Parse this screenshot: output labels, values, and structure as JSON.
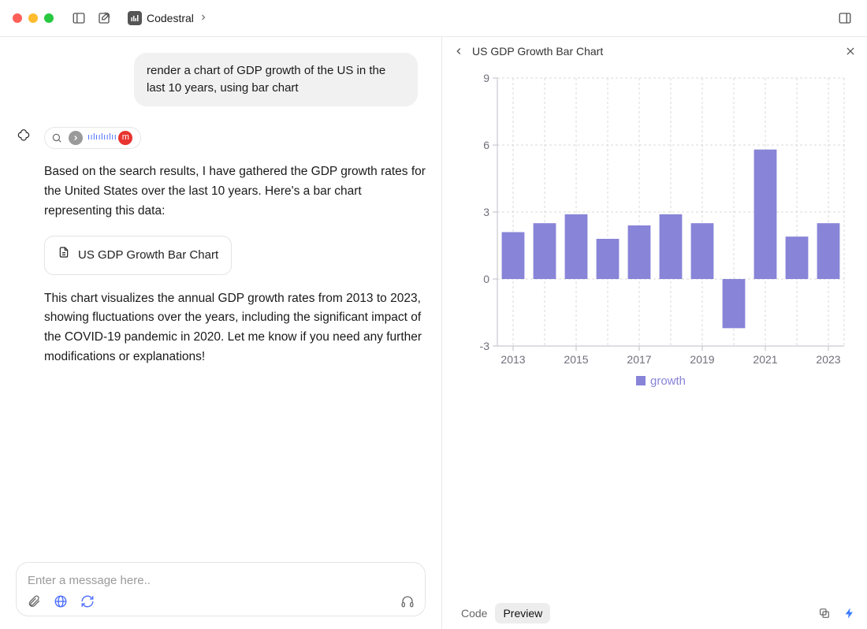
{
  "titlebar": {
    "model_name": "Codestral"
  },
  "chat": {
    "user_message": "render a chart of GDP growth of the US in the last 10 years, using bar chart",
    "assistant_para1": "Based on the search results, I have gathered the GDP growth rates for the United States over the last 10 years. Here's a bar chart representing this data:",
    "artifact_label": "US GDP Growth Bar Chart",
    "assistant_para2": "This chart visualizes the annual GDP growth rates from 2013 to 2023, showing fluctuations over the years, including the significant impact of the COVID-19 pandemic in 2020. Let me know if you need any further modifications or explanations!"
  },
  "composer": {
    "placeholder": "Enter a message here.."
  },
  "viewer": {
    "title": "US GDP Growth Bar Chart",
    "tab_code": "Code",
    "tab_preview": "Preview"
  },
  "chart_data": {
    "type": "bar",
    "series_name": "growth",
    "categories": [
      2013,
      2014,
      2015,
      2016,
      2017,
      2018,
      2019,
      2020,
      2021,
      2022,
      2023
    ],
    "values": [
      2.1,
      2.5,
      2.9,
      1.8,
      2.4,
      2.9,
      2.5,
      -2.2,
      5.8,
      1.9,
      2.5
    ],
    "x_tick_labels": [
      "2013",
      "2015",
      "2017",
      "2019",
      "2021",
      "2023"
    ],
    "y_ticks": [
      -3,
      0,
      3,
      6,
      9
    ],
    "ylim": [
      -3,
      9
    ],
    "bar_color": "#8884d8",
    "grid_color": "#d9d9d9"
  }
}
